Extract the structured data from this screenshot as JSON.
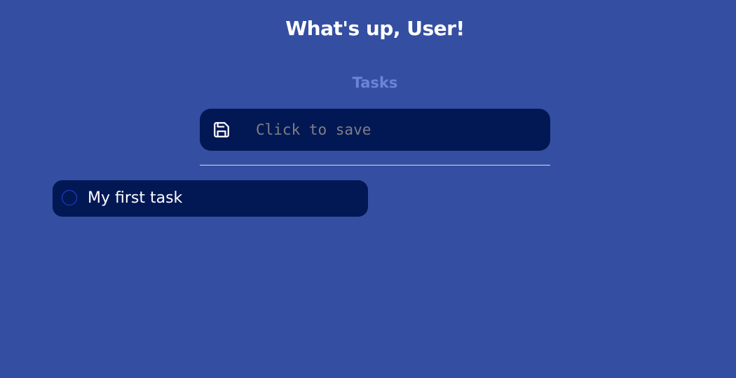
{
  "header": {
    "greeting": "What's up, User!"
  },
  "tasks_section": {
    "title": "Tasks"
  },
  "task_input": {
    "placeholder": "Click to save",
    "value": "",
    "save_icon": "floppy-disk-icon"
  },
  "tasks": [
    {
      "label": "My first task",
      "completed": false
    }
  ],
  "colors": {
    "background": "#344fa1",
    "card": "#021854",
    "accent_title": "#6b84d8",
    "checkbox_border": "#1f46d9"
  }
}
